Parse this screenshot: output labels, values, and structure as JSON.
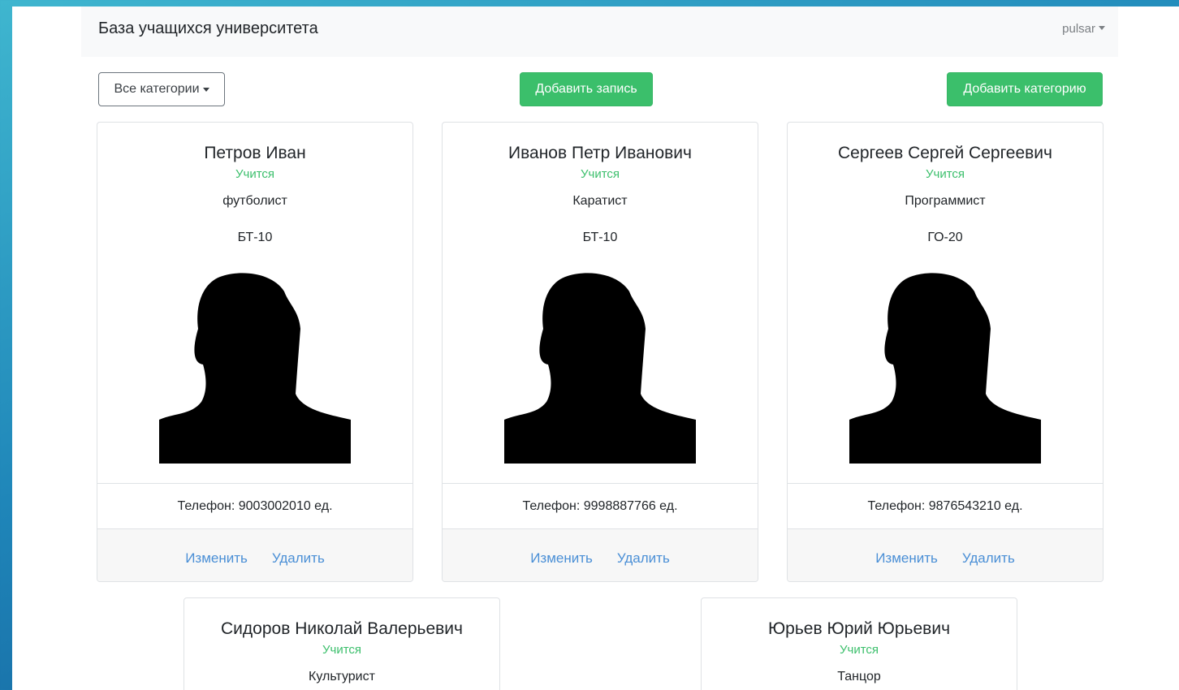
{
  "navbar": {
    "brand": "База учащихся университета",
    "user": "pulsar"
  },
  "toolbar": {
    "categories_label": "Все категории",
    "add_record_label": "Добавить запись",
    "add_category_label": "Добавить категорию"
  },
  "colors": {
    "success": "#3bbf6b",
    "link": "#4a8fd6"
  },
  "cards": [
    {
      "name": "Петров Иван",
      "status": "Учится",
      "category": "футболист",
      "group": "БТ-10",
      "phone": "Телефон: 9003002010 ед.",
      "edit": "Изменить",
      "delete": "Удалить"
    },
    {
      "name": "Иванов Петр Иванович",
      "status": "Учится",
      "category": "Каратист",
      "group": "БТ-10",
      "phone": "Телефон: 9998887766 ед.",
      "edit": "Изменить",
      "delete": "Удалить"
    },
    {
      "name": "Сергеев Сергей Сергеевич",
      "status": "Учится",
      "category": "Программист",
      "group": "ГО-20",
      "phone": "Телефон: 9876543210 ед.",
      "edit": "Изменить",
      "delete": "Удалить"
    },
    {
      "name": "Сидоров Николай Валерьевич",
      "status": "Учится",
      "category": "Культурист"
    },
    {
      "name": "Юрьев Юрий Юрьевич",
      "status": "Учится",
      "category": "Танцор"
    }
  ]
}
